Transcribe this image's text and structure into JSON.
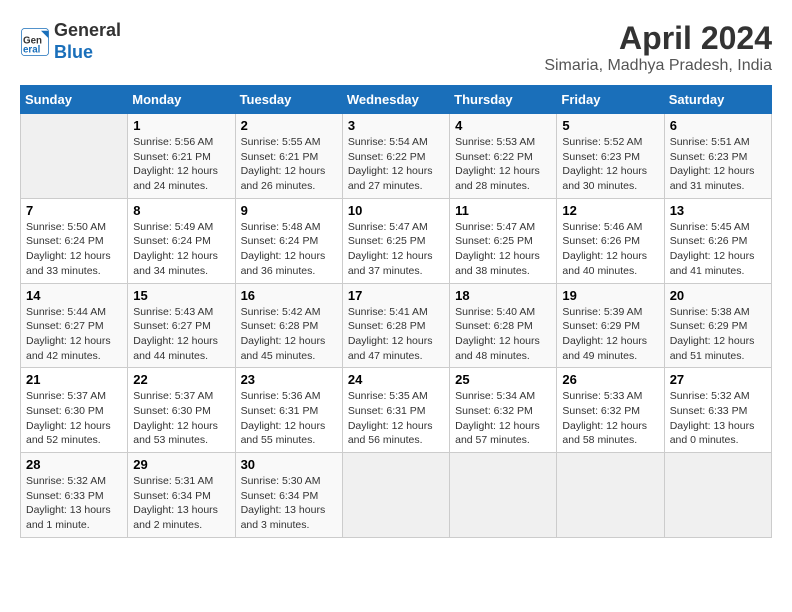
{
  "header": {
    "logo_general": "General",
    "logo_blue": "Blue",
    "month": "April 2024",
    "location": "Simaria, Madhya Pradesh, India"
  },
  "calendar": {
    "days_of_week": [
      "Sunday",
      "Monday",
      "Tuesday",
      "Wednesday",
      "Thursday",
      "Friday",
      "Saturday"
    ],
    "weeks": [
      [
        {
          "day": "",
          "info": ""
        },
        {
          "day": "1",
          "info": "Sunrise: 5:56 AM\nSunset: 6:21 PM\nDaylight: 12 hours\nand 24 minutes."
        },
        {
          "day": "2",
          "info": "Sunrise: 5:55 AM\nSunset: 6:21 PM\nDaylight: 12 hours\nand 26 minutes."
        },
        {
          "day": "3",
          "info": "Sunrise: 5:54 AM\nSunset: 6:22 PM\nDaylight: 12 hours\nand 27 minutes."
        },
        {
          "day": "4",
          "info": "Sunrise: 5:53 AM\nSunset: 6:22 PM\nDaylight: 12 hours\nand 28 minutes."
        },
        {
          "day": "5",
          "info": "Sunrise: 5:52 AM\nSunset: 6:23 PM\nDaylight: 12 hours\nand 30 minutes."
        },
        {
          "day": "6",
          "info": "Sunrise: 5:51 AM\nSunset: 6:23 PM\nDaylight: 12 hours\nand 31 minutes."
        }
      ],
      [
        {
          "day": "7",
          "info": "Sunrise: 5:50 AM\nSunset: 6:24 PM\nDaylight: 12 hours\nand 33 minutes."
        },
        {
          "day": "8",
          "info": "Sunrise: 5:49 AM\nSunset: 6:24 PM\nDaylight: 12 hours\nand 34 minutes."
        },
        {
          "day": "9",
          "info": "Sunrise: 5:48 AM\nSunset: 6:24 PM\nDaylight: 12 hours\nand 36 minutes."
        },
        {
          "day": "10",
          "info": "Sunrise: 5:47 AM\nSunset: 6:25 PM\nDaylight: 12 hours\nand 37 minutes."
        },
        {
          "day": "11",
          "info": "Sunrise: 5:47 AM\nSunset: 6:25 PM\nDaylight: 12 hours\nand 38 minutes."
        },
        {
          "day": "12",
          "info": "Sunrise: 5:46 AM\nSunset: 6:26 PM\nDaylight: 12 hours\nand 40 minutes."
        },
        {
          "day": "13",
          "info": "Sunrise: 5:45 AM\nSunset: 6:26 PM\nDaylight: 12 hours\nand 41 minutes."
        }
      ],
      [
        {
          "day": "14",
          "info": "Sunrise: 5:44 AM\nSunset: 6:27 PM\nDaylight: 12 hours\nand 42 minutes."
        },
        {
          "day": "15",
          "info": "Sunrise: 5:43 AM\nSunset: 6:27 PM\nDaylight: 12 hours\nand 44 minutes."
        },
        {
          "day": "16",
          "info": "Sunrise: 5:42 AM\nSunset: 6:28 PM\nDaylight: 12 hours\nand 45 minutes."
        },
        {
          "day": "17",
          "info": "Sunrise: 5:41 AM\nSunset: 6:28 PM\nDaylight: 12 hours\nand 47 minutes."
        },
        {
          "day": "18",
          "info": "Sunrise: 5:40 AM\nSunset: 6:28 PM\nDaylight: 12 hours\nand 48 minutes."
        },
        {
          "day": "19",
          "info": "Sunrise: 5:39 AM\nSunset: 6:29 PM\nDaylight: 12 hours\nand 49 minutes."
        },
        {
          "day": "20",
          "info": "Sunrise: 5:38 AM\nSunset: 6:29 PM\nDaylight: 12 hours\nand 51 minutes."
        }
      ],
      [
        {
          "day": "21",
          "info": "Sunrise: 5:37 AM\nSunset: 6:30 PM\nDaylight: 12 hours\nand 52 minutes."
        },
        {
          "day": "22",
          "info": "Sunrise: 5:37 AM\nSunset: 6:30 PM\nDaylight: 12 hours\nand 53 minutes."
        },
        {
          "day": "23",
          "info": "Sunrise: 5:36 AM\nSunset: 6:31 PM\nDaylight: 12 hours\nand 55 minutes."
        },
        {
          "day": "24",
          "info": "Sunrise: 5:35 AM\nSunset: 6:31 PM\nDaylight: 12 hours\nand 56 minutes."
        },
        {
          "day": "25",
          "info": "Sunrise: 5:34 AM\nSunset: 6:32 PM\nDaylight: 12 hours\nand 57 minutes."
        },
        {
          "day": "26",
          "info": "Sunrise: 5:33 AM\nSunset: 6:32 PM\nDaylight: 12 hours\nand 58 minutes."
        },
        {
          "day": "27",
          "info": "Sunrise: 5:32 AM\nSunset: 6:33 PM\nDaylight: 13 hours\nand 0 minutes."
        }
      ],
      [
        {
          "day": "28",
          "info": "Sunrise: 5:32 AM\nSunset: 6:33 PM\nDaylight: 13 hours\nand 1 minute."
        },
        {
          "day": "29",
          "info": "Sunrise: 5:31 AM\nSunset: 6:34 PM\nDaylight: 13 hours\nand 2 minutes."
        },
        {
          "day": "30",
          "info": "Sunrise: 5:30 AM\nSunset: 6:34 PM\nDaylight: 13 hours\nand 3 minutes."
        },
        {
          "day": "",
          "info": ""
        },
        {
          "day": "",
          "info": ""
        },
        {
          "day": "",
          "info": ""
        },
        {
          "day": "",
          "info": ""
        }
      ]
    ]
  }
}
